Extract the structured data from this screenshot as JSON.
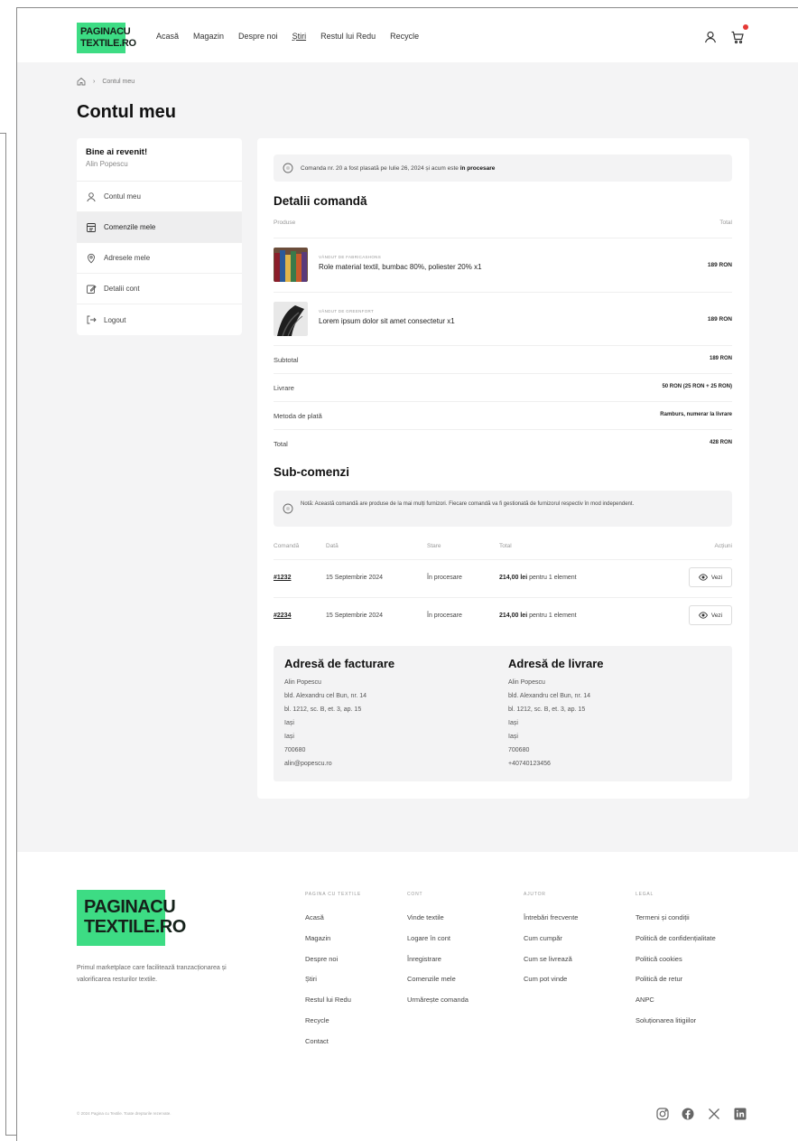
{
  "brand": {
    "logo_line1": "PAGINACU",
    "logo_line2": "TEXTILE.RO",
    "accent": "#3ddc84"
  },
  "nav": {
    "items": [
      "Acasă",
      "Magazin",
      "Despre noi",
      "Știri",
      "Restul lui Redu",
      "Recycle"
    ]
  },
  "header_icons": [
    "user-icon",
    "cart-icon"
  ],
  "breadcrumb": {
    "home_icon": "home-icon",
    "current": "Contul meu"
  },
  "page_title": "Contul meu",
  "sidebar": {
    "greeting": "Bine ai revenit!",
    "user": "Alin Popescu",
    "items": [
      {
        "label": "Contul meu",
        "icon": "user-icon"
      },
      {
        "label": "Comenzile mele",
        "icon": "orders-icon",
        "active": true
      },
      {
        "label": "Adresele mele",
        "icon": "location-icon"
      },
      {
        "label": "Detalii cont",
        "icon": "edit-icon"
      },
      {
        "label": "Logout",
        "icon": "logout-icon"
      }
    ]
  },
  "order": {
    "notice_prefix": "Comanda nr. 20 a fost plasată pe Iulie 26, 2024 și acum este",
    "notice_status": "în procesare",
    "details_title": "Detalii comandă",
    "col_products": "Produse",
    "col_total": "Total",
    "products": [
      {
        "category": "VÂNDUT DE FABRICASHONS",
        "name": "Role material textil, bumbac 80%, poliester 20% x1",
        "price": "189 RON"
      },
      {
        "category": "VÂNDUT DE GREENFORT",
        "name": "Lorem ipsum dolor sit amet consectetur x1",
        "price": "189 RON"
      }
    ],
    "summary": [
      {
        "label": "Subtotal",
        "value": "189 RON"
      },
      {
        "label": "Livrare",
        "value": "50 RON (25 RON + 25 RON)"
      },
      {
        "label": "Metoda de plată",
        "value": "Ramburs, numerar la livrare"
      },
      {
        "label": "Total",
        "value": "428 RON"
      }
    ]
  },
  "subcomenzi": {
    "title": "Sub-comenzi",
    "notice": "Notă: Această comandă are produse de la mai mulți furnizori. Fiecare comandă va fi gestionată de furnizorul respectiv în mod independent.",
    "headers": [
      "Comandă",
      "Dată",
      "Stare",
      "Total",
      "Acțiuni"
    ],
    "rows": [
      {
        "id": "#1232",
        "date": "15 Septembrie 2024",
        "status": "În procesare",
        "total_amount": "214,00 lei",
        "total_suffix": "pentru 1 element",
        "action": "Vezi"
      },
      {
        "id": "#2234",
        "date": "15 Septembrie 2024",
        "status": "În procesare",
        "total_amount": "214,00 lei",
        "total_suffix": "pentru 1 element",
        "action": "Vezi"
      }
    ]
  },
  "billing": {
    "title": "Adresă de facturare",
    "lines": [
      "Alin Popescu",
      "bld. Alexandru cel Bun, nr. 14",
      "bl. 1212, sc. B, et. 3, ap. 15",
      "Iași",
      "Iași",
      "700680",
      "alin@popescu.ro"
    ]
  },
  "shipping": {
    "title": "Adresă de livrare",
    "lines": [
      "Alin Popescu",
      "bld. Alexandru cel Bun, nr. 14",
      "bl. 1212, sc. B, et. 3, ap. 15",
      "Iași",
      "Iași",
      "700680",
      "+40740123456"
    ]
  },
  "footer": {
    "description": "Primul marketplace care facilitează tranzacționarea și valorificarea resturilor textile.",
    "columns": [
      {
        "heading": "PAGINA CU TEXTILE",
        "items": [
          "Acasă",
          "Magazin",
          "Despre noi",
          "Știri",
          "Restul lui Redu",
          "Recycle",
          "Contact"
        ]
      },
      {
        "heading": "CONT",
        "items": [
          "Vinde textile",
          "Logare în cont",
          "Înregistrare",
          "Comenzile mele",
          "Urmărește comanda"
        ]
      },
      {
        "heading": "AJUTOR",
        "items": [
          "Întrebări frecvente",
          "Cum cumpăr",
          "Cum se livrează",
          "Cum pot vinde"
        ]
      },
      {
        "heading": "LEGAL",
        "items": [
          "Termeni și condiții",
          "Politică de confidențialitate",
          "Politică cookies",
          "Politică de retur",
          "ANPC",
          "Soluționarea litigiilor"
        ]
      }
    ],
    "copyright": "© 2024 Pagina cu Textile. Toate drepturile rezervate.",
    "social_icons": [
      "instagram-icon",
      "facebook-icon",
      "x-icon",
      "linkedin-icon"
    ]
  }
}
